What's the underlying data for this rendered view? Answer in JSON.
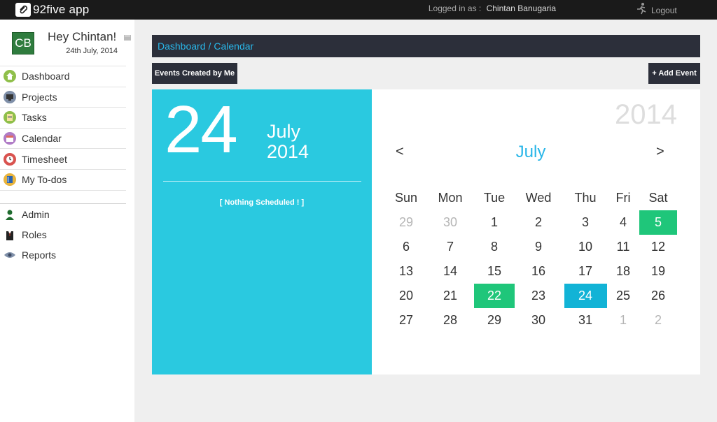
{
  "app": {
    "logo_text": "92five app"
  },
  "topbar": {
    "logged_in_label": "Logged in as :",
    "user_name": "Chintan Banugaria",
    "logout_label": "Logout"
  },
  "profile": {
    "initials": "CB",
    "greeting": "Hey Chintan!",
    "date": "24th July, 2014"
  },
  "sidebar": {
    "items": [
      {
        "label": "Dashboard",
        "icon": "home-icon",
        "color": "#8fbf4a"
      },
      {
        "label": "Projects",
        "icon": "monitor-icon",
        "color": "#7f8fa8"
      },
      {
        "label": "Tasks",
        "icon": "clipboard-icon",
        "color": "#8fbf4a"
      },
      {
        "label": "Calendar",
        "icon": "calendar-icon",
        "color": "#b07cc6"
      },
      {
        "label": "Timesheet",
        "icon": "clock-icon",
        "color": "#d9534f"
      },
      {
        "label": "My To-dos",
        "icon": "book-icon",
        "color": "#e8b33c"
      }
    ],
    "admin_items": [
      {
        "label": "Admin",
        "icon": "user-icon"
      },
      {
        "label": "Roles",
        "icon": "suit-icon"
      },
      {
        "label": "Reports",
        "icon": "eye-icon"
      }
    ]
  },
  "breadcrumb": {
    "root": "Dashboard",
    "separator": "/",
    "current": "Calendar"
  },
  "buttons": {
    "events_created": "Events Created by Me",
    "add_event": "+ Add Event"
  },
  "selected": {
    "day": "24",
    "month": "July",
    "year": "2014",
    "schedule_text": "[ Nothing Scheduled ! ]"
  },
  "calendar": {
    "year": "2014",
    "month": "July",
    "prev": "<",
    "next": ">",
    "weekdays": [
      "Sun",
      "Mon",
      "Tue",
      "Wed",
      "Thu",
      "Fri",
      "Sat"
    ],
    "weeks": [
      [
        "29",
        "30",
        "1",
        "2",
        "3",
        "4",
        "5"
      ],
      [
        "6",
        "7",
        "8",
        "9",
        "10",
        "11",
        "12"
      ],
      [
        "13",
        "14",
        "15",
        "16",
        "17",
        "18",
        "19"
      ],
      [
        "20",
        "21",
        "22",
        "23",
        "24",
        "25",
        "26"
      ],
      [
        "27",
        "28",
        "29",
        "30",
        "31",
        "1",
        "2"
      ]
    ],
    "muted": [
      [
        0,
        0
      ],
      [
        0,
        1
      ],
      [
        4,
        5
      ],
      [
        4,
        6
      ]
    ],
    "event_days": [
      [
        0,
        6
      ],
      [
        3,
        2
      ]
    ],
    "today": [
      3,
      4
    ],
    "colors": {
      "event": "#1fc67a",
      "today": "#12b3d6",
      "accent": "#29b6e8",
      "panel": "#2ac9e0"
    }
  }
}
